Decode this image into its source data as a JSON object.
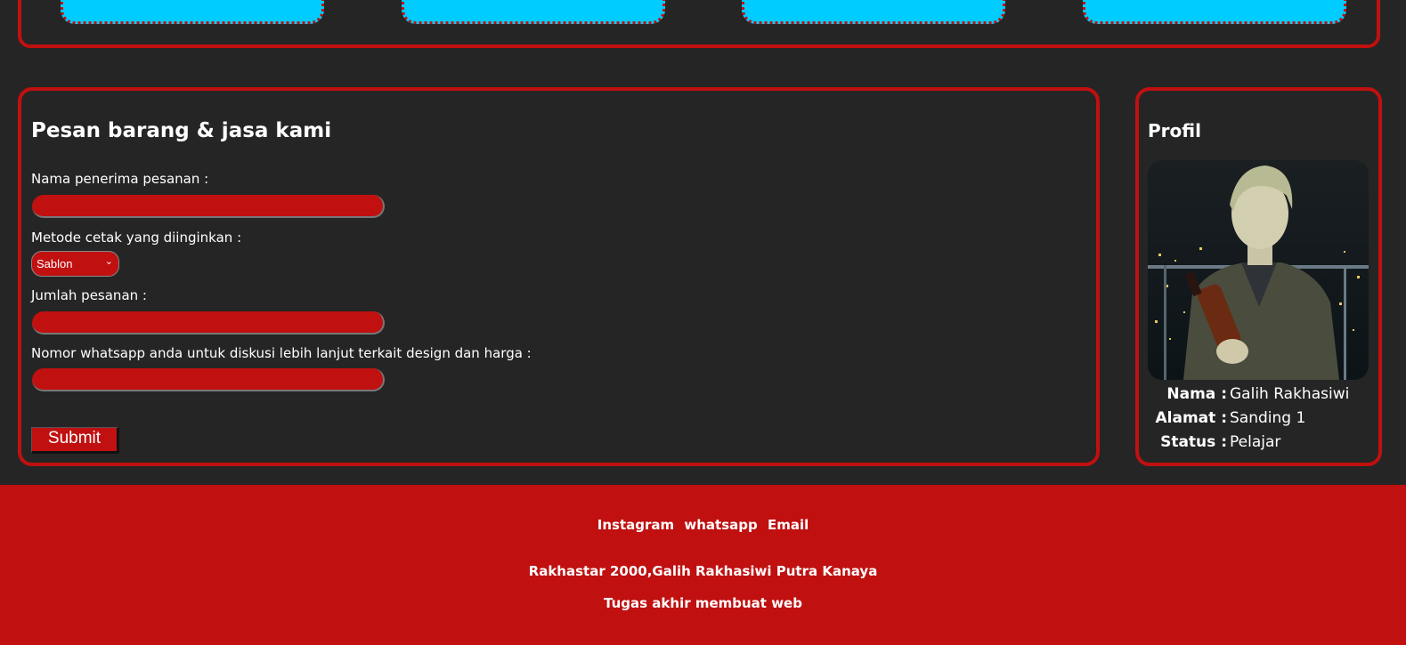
{
  "form": {
    "title": "Pesan barang & jasa kami",
    "name_label": "Nama penerima pesanan :",
    "method_label": "Metode cetak yang diinginkan :",
    "method_selected": "Sablon",
    "quantity_label": "Jumlah pesanan :",
    "whatsapp_label": "Nomor whatsapp anda untuk diskusi lebih lanjut terkait design dan harga :",
    "submit_label": "Submit"
  },
  "profile": {
    "title": "Profil",
    "rows": [
      {
        "key": "Nama :",
        "value": "Galih Rakhasiwi"
      },
      {
        "key": "Alamat :",
        "value": "Sanding 1"
      },
      {
        "key": "Status :",
        "value": "Pelajar"
      }
    ]
  },
  "footer": {
    "links": [
      "Instagram",
      "whatsapp",
      "Email"
    ],
    "credit": "Rakhastar 2000,Galih Rakhasiwi Putra Kanaya",
    "note": "Tugas akhir membuat web"
  },
  "colors": {
    "accent": "#c01010",
    "background": "#252525",
    "card": "#00ccff"
  }
}
